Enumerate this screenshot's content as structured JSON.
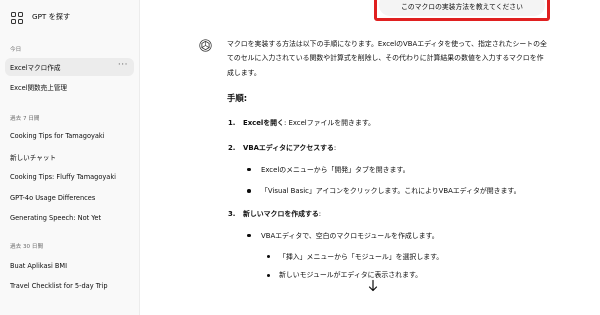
{
  "sidebar": {
    "explore_gpts": "GPT を探す",
    "sections": [
      {
        "label": "今日",
        "items": [
          {
            "label": "Excelマクロ作成",
            "active": true,
            "more": "···"
          },
          {
            "label": "Excel関数売上管理"
          }
        ]
      },
      {
        "label": "過去 7 日間",
        "items": [
          {
            "label": "Cooking Tips for Tamagoyaki"
          },
          {
            "label": "新しいチャット"
          },
          {
            "label": "Cooking Tips: Fluffy Tamagoyaki"
          },
          {
            "label": "GPT-4o Usage Differences"
          },
          {
            "label": "Generating Speech: Not Yet"
          }
        ]
      },
      {
        "label": "過去 30 日間",
        "items": [
          {
            "label": "Buat Aplikasi BMI"
          },
          {
            "label": "Travel Checklist for 5-day Trip"
          }
        ]
      }
    ]
  },
  "chat": {
    "user_message": "このマクロの実装方法を教えてください",
    "assistant": {
      "intro": "マクロを実装する方法は以下の手順になります。ExcelのVBAエディタを使って、指定されたシートの全てのセルに入力されている関数や計算式を削除し、その代わりに計算結果の数値を入力するマクロを作成します。",
      "heading": "手順:",
      "steps": [
        {
          "num": "1.",
          "title": "Excelを開く",
          "text": ": Excelファイルを開きます。"
        },
        {
          "num": "2.",
          "title": "VBAエディタにアクセスする",
          "text": ":",
          "bullets": [
            "Excelのメニューから「開発」タブを開きます。",
            "「Visual Basic」アイコンをクリックします。これによりVBAエディタが開きます。"
          ]
        },
        {
          "num": "3.",
          "title": "新しいマクロを作成する",
          "text": ":",
          "bullets": [
            "VBAエディタで、空白のマクロモジュールを作成します。"
          ],
          "sub_bullets": [
            "「挿入」メニューから「モジュール」を選択します。",
            "新しいモジュールがエディタに表示されます。"
          ]
        }
      ]
    }
  },
  "colors": {
    "highlight": "#e02020",
    "sidebar_bg": "#f9f9f9",
    "bubble_bg": "#f4f4f4"
  },
  "icons": {
    "explore": "grid-icon",
    "assistant": "openai-logo-icon",
    "scroll": "arrow-down-icon",
    "more": "ellipsis-icon"
  }
}
